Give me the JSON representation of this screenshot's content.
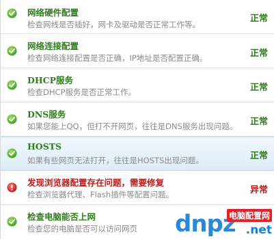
{
  "items": [
    {
      "title": "网络硬件配置",
      "desc": "检查网线是否插好，网卡及驱动是否正常工作等。",
      "status": "正常",
      "ok": true
    },
    {
      "title": "网络连接配置",
      "desc": "检查网络连接配置是否正确，IP地址是否配置正确。",
      "status": "正常",
      "ok": true
    },
    {
      "title": "DHCP服务",
      "desc": "检查DHCP服务是否正常工作。",
      "status": "正常",
      "ok": true
    },
    {
      "title": "DNS服务",
      "desc": "如果您能上QQ，但打不开网页，往往是DNS服务出现问题。",
      "status": "正常",
      "ok": true
    },
    {
      "title": "HOSTS",
      "desc": "如果有些网页无法打开，往往是HOSTS出现问题。",
      "status": "正常",
      "ok": true
    },
    {
      "title": "发现浏览器配置存在问题，需要修复",
      "desc": "检查浏览器代理、Flash插件等配置问题。",
      "status": "异常",
      "ok": false
    },
    {
      "title": "检查电脑能否上网",
      "desc": "检查您的电脑是否可以访问网页",
      "status": "",
      "ok": true
    }
  ],
  "watermark": {
    "brand": "dnpz",
    "site": "电脑配置网",
    "tld": ".net"
  },
  "colors": {
    "ok": "#2f7d1e",
    "error": "#b91d1d",
    "description": "#8a8a8a",
    "selected_row": "#dcecf8"
  },
  "icons": {
    "ok": "check-circle-icon",
    "error": "exclamation-circle-icon"
  }
}
